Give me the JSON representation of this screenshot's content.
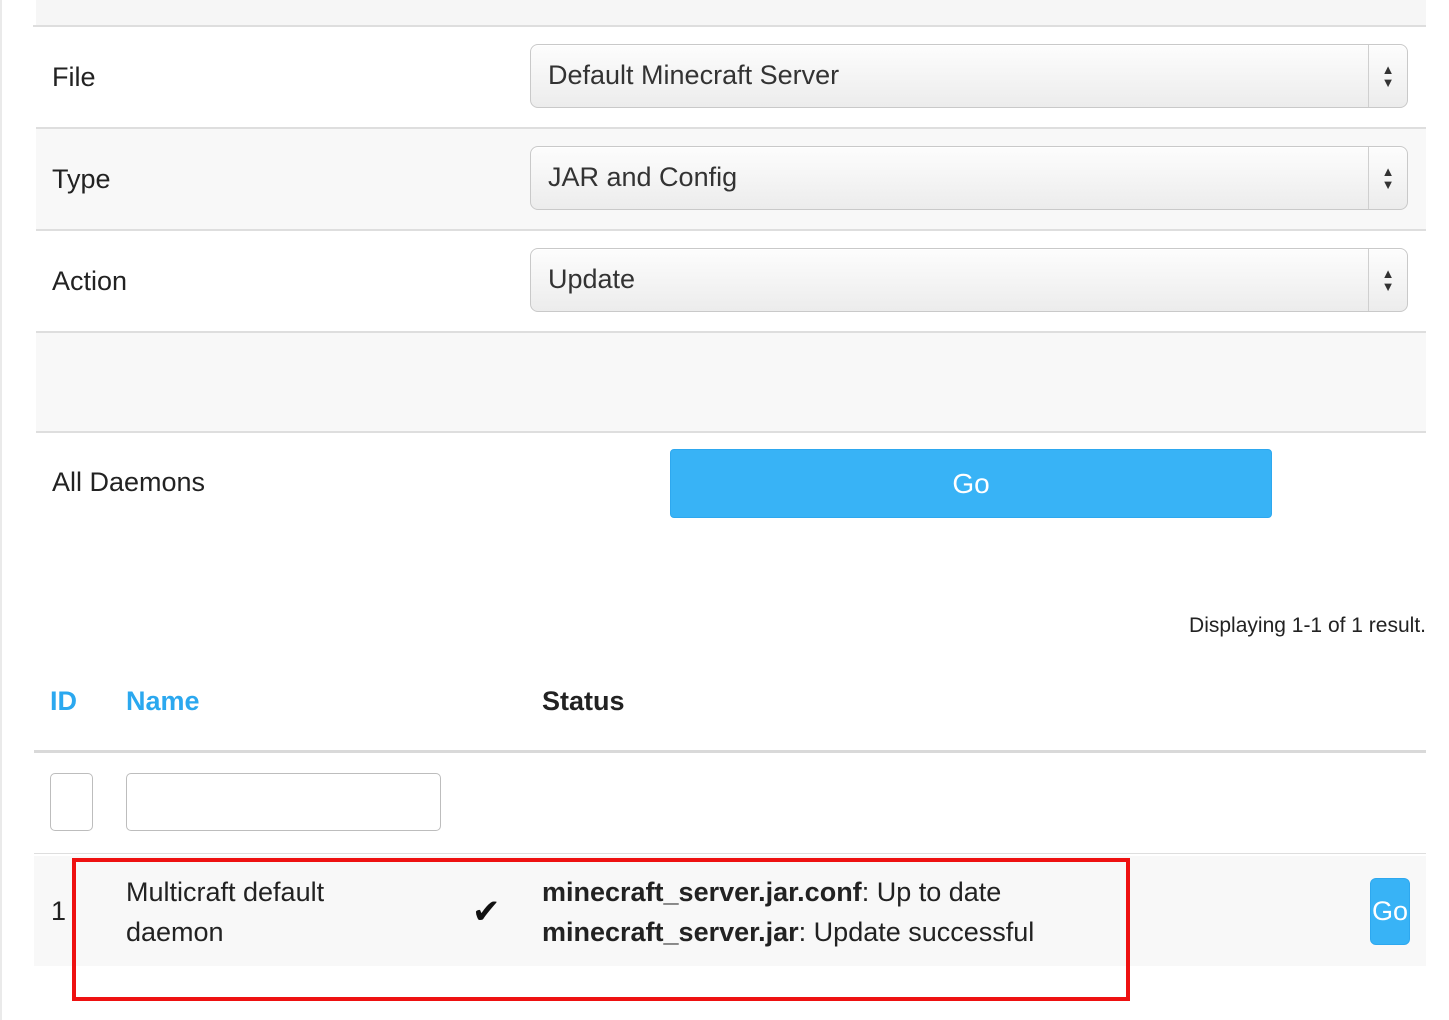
{
  "form": {
    "file": {
      "label": "File",
      "value": "Default Minecraft Server"
    },
    "type": {
      "label": "Type",
      "value": "JAR and Config"
    },
    "action": {
      "label": "Action",
      "value": "Update"
    },
    "daemons_label": "All Daemons",
    "go_label": "Go"
  },
  "results": {
    "summary": "Displaying 1-1 of 1 result.",
    "columns": {
      "id": "ID",
      "name": "Name",
      "status": "Status"
    },
    "rows": [
      {
        "id": "1",
        "name": "Multicraft default daemon",
        "status_lines": [
          {
            "file": "minecraft_server.jar.conf",
            "message": ": Up to date"
          },
          {
            "file": "minecraft_server.jar",
            "message": ": Update successful"
          }
        ],
        "go_label": "Go"
      }
    ]
  },
  "icons": {
    "select_arrows": "updown-arrows-icon",
    "status": "checkmark-icon"
  },
  "colors": {
    "accent": "#38b3f6",
    "link": "#2ba8ef",
    "highlight": "#ee1111"
  }
}
